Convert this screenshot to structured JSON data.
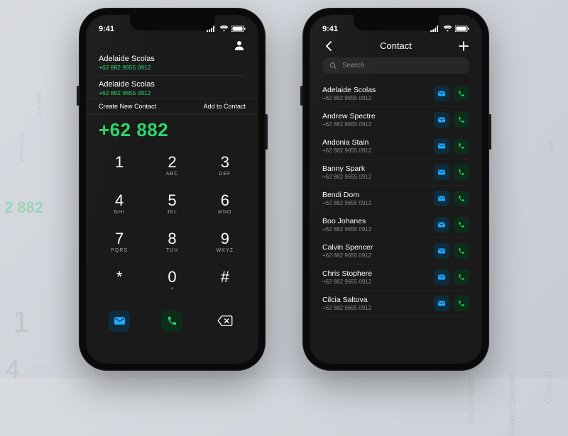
{
  "status": {
    "time": "9:41"
  },
  "dialer": {
    "suggestions": [
      {
        "name": "Adelaide Scolas",
        "number": "+62 882 9655 0912"
      },
      {
        "name": "Adelaide Scolas",
        "number": "+62 882 9655 0912"
      }
    ],
    "create_label": "Create New Contact",
    "add_label": "Add to Contact",
    "entered_number": "+62 882",
    "keys": [
      {
        "d": "1",
        "l": ""
      },
      {
        "d": "2",
        "l": "ABC"
      },
      {
        "d": "3",
        "l": "DEF"
      },
      {
        "d": "4",
        "l": "GHI"
      },
      {
        "d": "5",
        "l": "JKL"
      },
      {
        "d": "6",
        "l": "MNO"
      },
      {
        "d": "7",
        "l": "PQRS"
      },
      {
        "d": "8",
        "l": "TUV"
      },
      {
        "d": "9",
        "l": "WXYZ"
      },
      {
        "d": "*",
        "l": ""
      },
      {
        "d": "0",
        "l": "+"
      },
      {
        "d": "#",
        "l": ""
      }
    ]
  },
  "contacts": {
    "title": "Contact",
    "search_placeholder": "Search",
    "list": [
      {
        "name": "Adelaide Scolas",
        "phone": "+62 882 9655 0912"
      },
      {
        "name": "Andrew Spectre",
        "phone": "+62 882 9655 0912"
      },
      {
        "name": "Andonia Stain",
        "phone": "+62 882 9655 0912"
      },
      {
        "name": "Banny Spark",
        "phone": "+62 882 9655 0912"
      },
      {
        "name": "Bendi Dom",
        "phone": "+62 882 9655 0912"
      },
      {
        "name": "Boo Johanes",
        "phone": "+62 882 9655 0912"
      },
      {
        "name": "Calvin Spencer",
        "phone": "+62 882 9655 0912"
      },
      {
        "name": "Chris Stophere",
        "phone": "+62 882 9655 0912"
      },
      {
        "name": "Cilcia Saltova",
        "phone": "+62 882 9655 0912"
      }
    ]
  },
  "colors": {
    "accent_green": "#2dd46b",
    "mail_blue": "#22a8ff",
    "call_green": "#2dd46b"
  }
}
